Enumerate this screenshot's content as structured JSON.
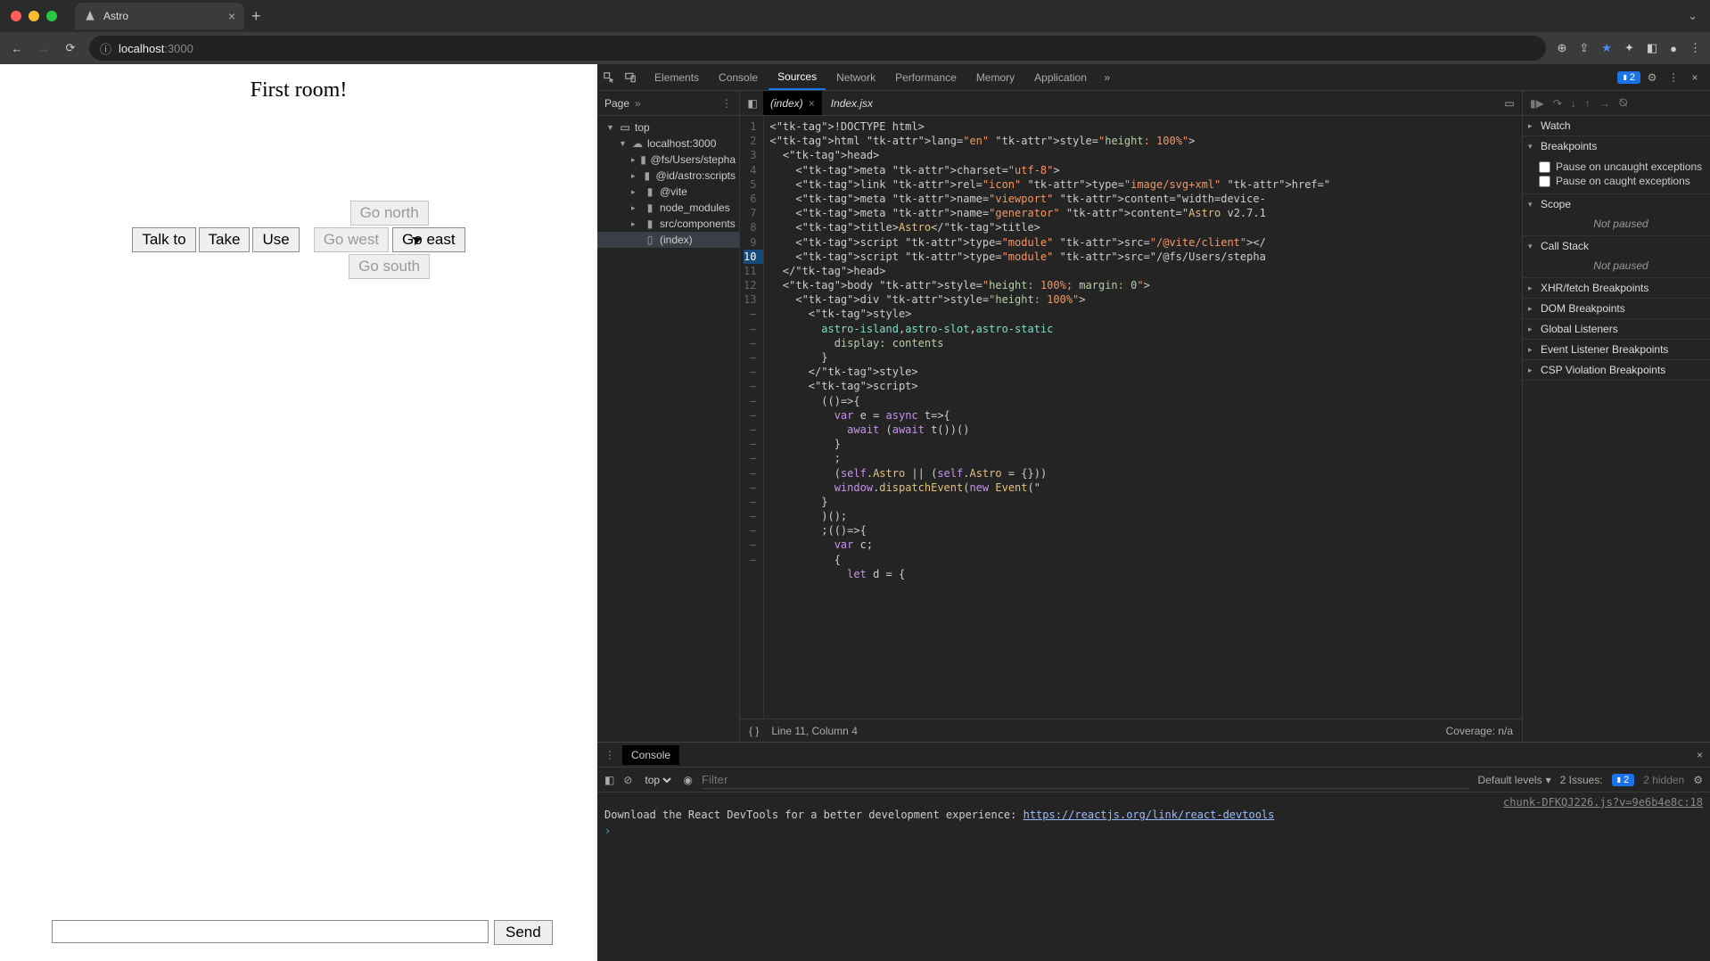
{
  "browser": {
    "tab_title": "Astro",
    "url_host": "localhost",
    "url_port": ":3000"
  },
  "game": {
    "room_title": "First room!",
    "actions": {
      "talk_to": "Talk to",
      "take": "Take",
      "use": "Use"
    },
    "directions": {
      "north": "Go north",
      "west": "Go west",
      "east": "Go east",
      "south": "Go south"
    },
    "send_label": "Send"
  },
  "devtools": {
    "tabs": [
      "Elements",
      "Console",
      "Sources",
      "Network",
      "Performance",
      "Memory",
      "Application"
    ],
    "active_tab": "Sources",
    "issues_count": "2",
    "sources": {
      "nav_label": "Page",
      "tree": {
        "top": "top",
        "host": "localhost:3000",
        "folders": [
          "@fs/Users/stepha",
          "@id/astro:scripts",
          "@vite",
          "node_modules",
          "src/components"
        ],
        "file": "(index)"
      },
      "open_tabs": [
        "(index)",
        "Index.jsx"
      ],
      "active_open_tab": "(index)",
      "gutter": [
        "1",
        "2",
        "3",
        "4",
        "5",
        "6",
        "7",
        "8",
        "9",
        "10",
        "11",
        "12",
        "13",
        "–",
        "–",
        "–",
        "–",
        "–",
        "–",
        "–",
        "–",
        "–",
        "–",
        "–",
        "–",
        "–",
        "–",
        "–",
        "–",
        "–",
        "–"
      ],
      "highlight_line": "10",
      "code_lines": [
        "<!DOCTYPE html>",
        "<html lang=\"en\" style=\"height: 100%\">",
        "  <head>",
        "    <meta charset=\"utf-8\">",
        "    <link rel=\"icon\" type=\"image/svg+xml\" href=\"",
        "    <meta name=\"viewport\" content=\"width=device-",
        "    <meta name=\"generator\" content=\"Astro v2.7.1",
        "    <title>Astro</title>",
        "    <script type=\"module\" src=\"/@vite/client\"></",
        "    <script type=\"module\" src=\"/@fs/Users/stepha",
        "  </head>",
        "  <body style=\"height: 100%; margin: 0\">",
        "    <div style=\"height: 100%\">",
        "      <style>",
        "        astro-island,astro-slot,astro-static",
        "          display: contents",
        "        }",
        "      </style>",
        "      <script>",
        "        (()=>{",
        "          var e = async t=>{",
        "            await (await t())()",
        "          }",
        "          ;",
        "          (self.Astro || (self.Astro = {}))",
        "          window.dispatchEvent(new Event(\"",
        "        }",
        "        )();",
        "        ;(()=>{",
        "          var c;",
        "          {",
        "            let d = {"
      ],
      "status_line": "Line 11, Column 4",
      "coverage": "Coverage: n/a"
    },
    "debugger": {
      "sections": {
        "watch": "Watch",
        "breakpoints": "Breakpoints",
        "pause_uncaught": "Pause on uncaught exceptions",
        "pause_caught": "Pause on caught exceptions",
        "scope": "Scope",
        "not_paused": "Not paused",
        "call_stack": "Call Stack",
        "xhr": "XHR/fetch Breakpoints",
        "dom": "DOM Breakpoints",
        "global": "Global Listeners",
        "event": "Event Listener Breakpoints",
        "csp": "CSP Violation Breakpoints"
      }
    },
    "console": {
      "drawer_label": "Console",
      "context": "top",
      "filter_placeholder": "Filter",
      "levels": "Default levels",
      "issues_label": "2 Issues:",
      "issues_badge": "2",
      "hidden": "2 hidden",
      "source_ref": "chunk-DFKQJ226.js?v=9e6b4e8c:18",
      "message_prefix": "Download the React DevTools for a better development experience: ",
      "message_link": "https://reactjs.org/link/react-devtools"
    }
  }
}
